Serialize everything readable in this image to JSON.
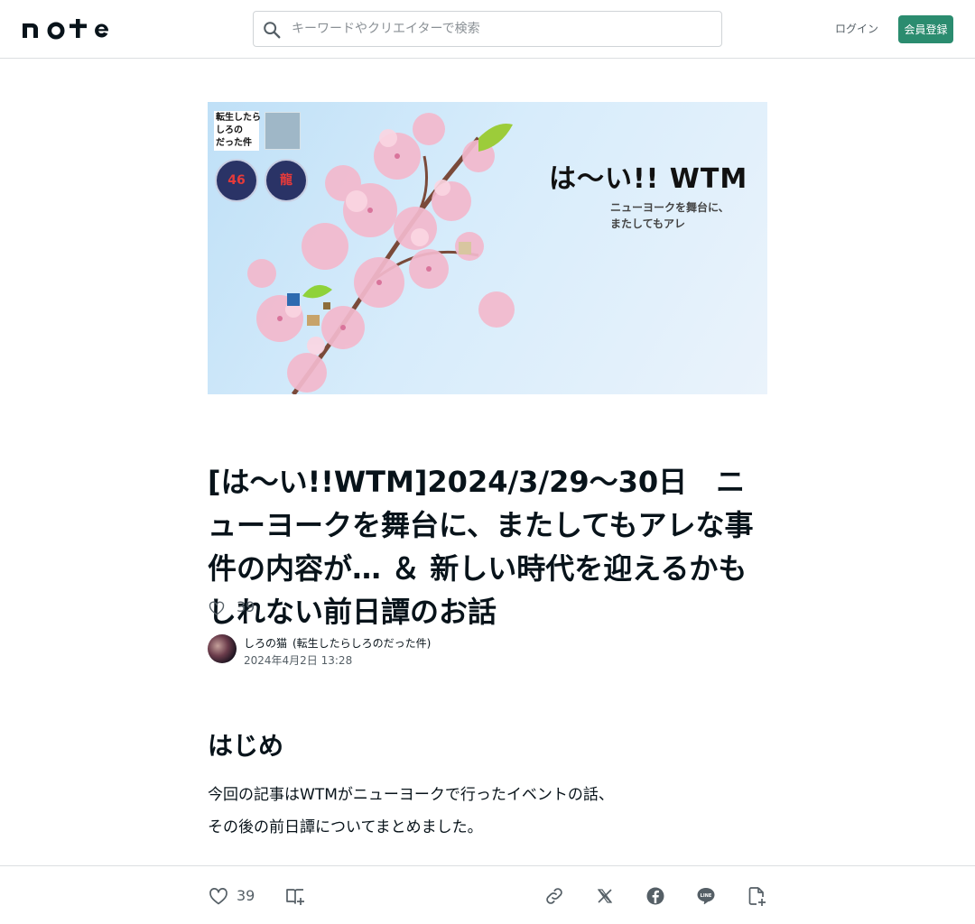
{
  "header": {
    "logo_text": "note",
    "search_placeholder": "キーワードやクリエイターで検索",
    "login_label": "ログイン",
    "signup_label": "会員登録"
  },
  "hero": {
    "title": "は〜い!! WTM",
    "subtitle": "ニューヨークを舞台に、\nまたしてもアレ",
    "badge_text": "転生したら\nしろの\nだった件",
    "jersey_1": "46",
    "jersey_2": "龍"
  },
  "article": {
    "title": "[は〜い!!WTM]2024/3/29〜30日　ニューヨークを舞台に、またしてもアレな事件の内容が… ＆ 新しい時代を迎えるかもしれない前日譚のお話",
    "like_count": "39",
    "author_name": "しろの猫",
    "author_handle": "(転生したらしろのだった件)",
    "date": "2024年4月2日 13:28",
    "section_heading": "はじめ",
    "body_line_1": "今回の記事はWTMがニューヨークで行ったイベントの話、",
    "body_line_2": "その後の前日譚についてまとめました。"
  },
  "bottom_bar": {
    "like_count": "39",
    "icons": [
      "heart-icon",
      "magazine-add-icon",
      "link-icon",
      "x-icon",
      "facebook-icon",
      "line-icon",
      "clip-add-icon"
    ]
  },
  "colors": {
    "brand_green": "#2b8c6f",
    "text_primary": "#08131a",
    "text_secondary": "#555f66"
  }
}
